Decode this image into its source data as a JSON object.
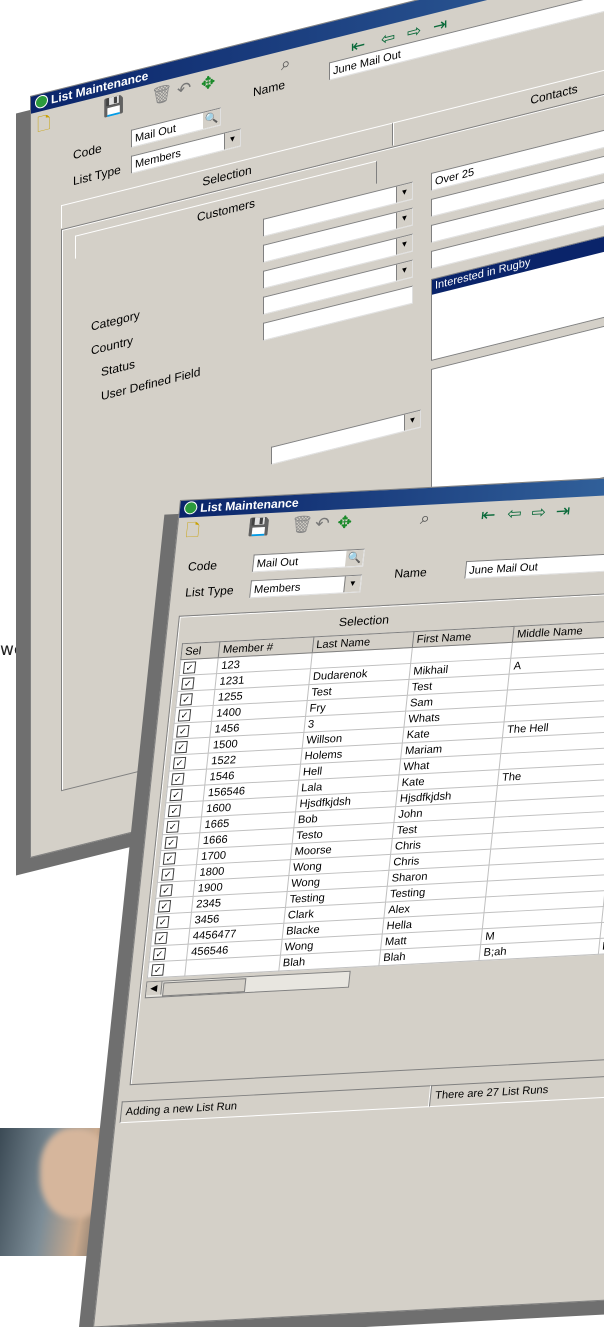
{
  "back_window": {
    "title": "List Maintenance",
    "code_label": "Code",
    "code_value": "Mail Out",
    "name_label": "Name",
    "name_value": "June Mail Out",
    "list_type_label": "List Type",
    "list_type_value": "Members",
    "tabs": [
      "Selection",
      "Contacts"
    ],
    "sub_tab": "Customers",
    "filter_labels": [
      "Category",
      "Country",
      "Status",
      "User Defined Field"
    ],
    "right_value": "Over 25",
    "list_selected": "Interested in Rugby"
  },
  "front_window": {
    "title": "List Maintenance",
    "code_label": "Code",
    "code_value": "Mail Out",
    "name_label": "Name",
    "name_value": "June Mail Out",
    "list_type_label": "List Type",
    "list_type_value": "Members",
    "selection_label": "Selection",
    "columns": [
      "Sel",
      "Member #",
      "Last Name",
      "First Name",
      "Middle Name"
    ],
    "rows": [
      [
        "123",
        "",
        "",
        "",
        ""
      ],
      [
        "1231",
        "Dudarenok",
        "Mikhail",
        "A",
        ""
      ],
      [
        "1255",
        "Test",
        "Test",
        "",
        ""
      ],
      [
        "1400",
        "Fry",
        "Sam",
        "",
        ""
      ],
      [
        "1456",
        "3",
        "Whats",
        "",
        ""
      ],
      [
        "1500",
        "Willson",
        "Kate",
        "The Hell",
        ""
      ],
      [
        "1522",
        "Holems",
        "Mariam",
        "",
        ""
      ],
      [
        "1546",
        "Hell",
        "What",
        "",
        ""
      ],
      [
        "156546",
        "Lala",
        "Kate",
        "The",
        ""
      ],
      [
        "1600",
        "Hjsdfkjdsh",
        "Hjsdfkjdsh",
        "",
        ""
      ],
      [
        "1665",
        "Bob",
        "John",
        "",
        ""
      ],
      [
        "1666",
        "Testo",
        "Test",
        "",
        ""
      ],
      [
        "1700",
        "Moorse",
        "Chris",
        "",
        ""
      ],
      [
        "1800",
        "Wong",
        "Chris",
        "",
        ""
      ],
      [
        "1900",
        "Wong",
        "Sharon",
        "",
        ""
      ],
      [
        "2345",
        "Testing",
        "Testing",
        "",
        ""
      ],
      [
        "3456",
        "Clark",
        "Alex",
        "",
        ""
      ],
      [
        "4456477",
        "Blacke",
        "Hella",
        "",
        ""
      ],
      [
        "456546",
        "Wong",
        "Matt",
        "M",
        ""
      ],
      [
        "",
        "Blah",
        "Blah",
        "B;ah",
        "Blah"
      ]
    ],
    "status_left": "Adding a new List Run",
    "status_right": "There are 27 List Runs"
  },
  "stray_text": "web"
}
